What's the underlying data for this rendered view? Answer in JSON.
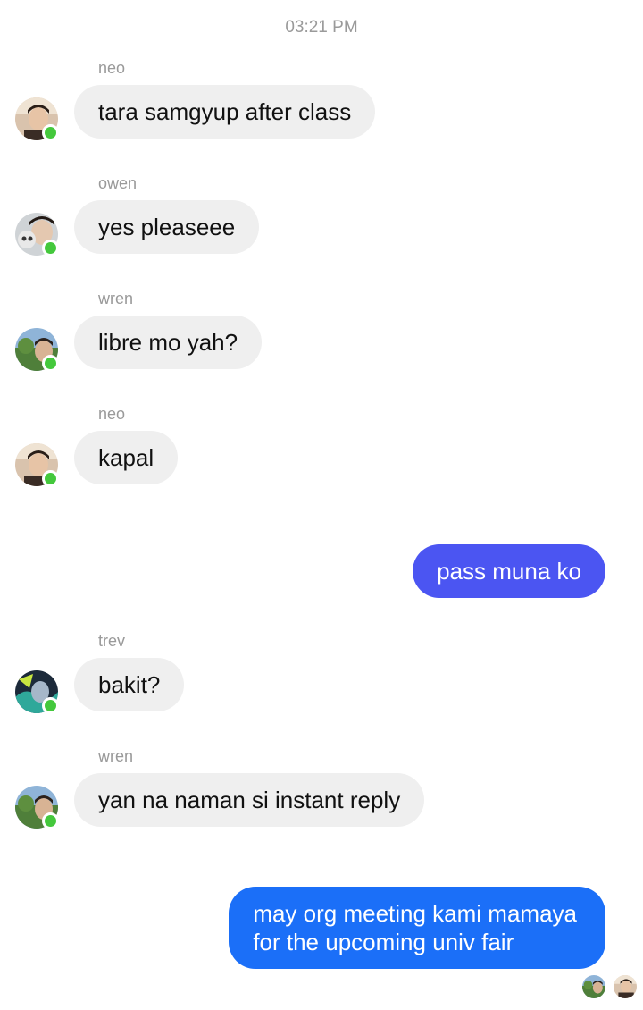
{
  "timestamp": "03:21 PM",
  "colors": {
    "incoming_bubble": "#efefef",
    "outgoing_purple": "#4b55f2",
    "outgoing_blue": "#1b6ff8",
    "online_dot": "#44c83c",
    "meta_text": "#9a9a9a"
  },
  "messages": [
    {
      "sender": "neo",
      "text": "tara samgyup after class",
      "avatar": "neo-avatar",
      "online": true
    },
    {
      "sender": "owen",
      "text": "yes pleaseee",
      "avatar": "owen-avatar",
      "online": true
    },
    {
      "sender": "wren",
      "text": "libre mo yah?",
      "avatar": "wren-avatar",
      "online": true
    },
    {
      "sender": "neo",
      "text": "kapal",
      "avatar": "neo-avatar",
      "online": true
    },
    {
      "sender": "me",
      "text": "pass muna ko"
    },
    {
      "sender": "trev",
      "text": "bakit?",
      "avatar": "trev-avatar",
      "online": true
    },
    {
      "sender": "wren",
      "text": "yan na naman si instant reply",
      "avatar": "wren-avatar",
      "online": true
    },
    {
      "sender": "me",
      "lines": [
        "may org meeting kami mamaya",
        "for the upcoming univ fair"
      ]
    }
  ],
  "seen_by": [
    "wren-avatar",
    "neo-avatar"
  ]
}
